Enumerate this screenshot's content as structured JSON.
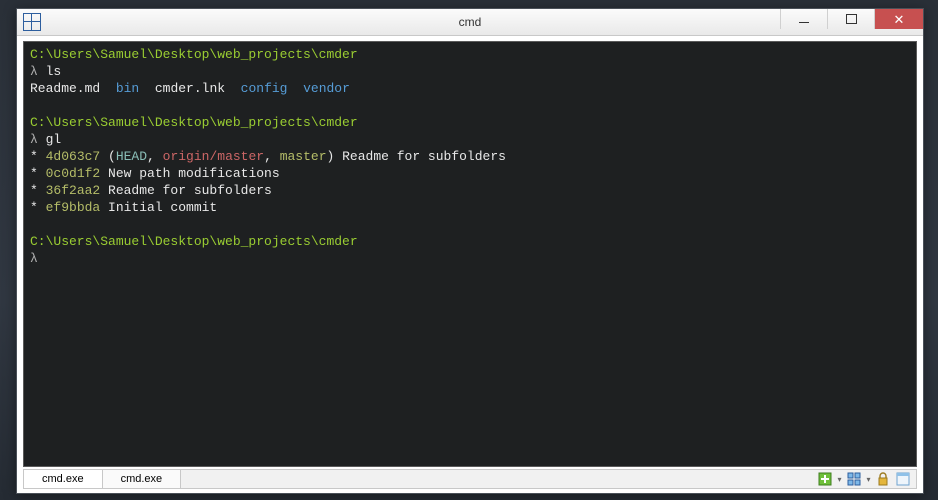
{
  "window": {
    "title": "cmd"
  },
  "tabs": [
    {
      "label": "cmd.exe",
      "active": true
    },
    {
      "label": "cmd.exe",
      "active": false
    }
  ],
  "terminal": {
    "path": "C:\\Users\\Samuel\\Desktop\\web_projects\\cmder",
    "prompt_symbol": "λ",
    "cmd_ls": "ls",
    "cmd_gl": "gl",
    "ls_plain1": "Readme.md",
    "ls_dir1": "bin",
    "ls_plain2": "cmder.lnk",
    "ls_dir2": "config",
    "ls_dir3": "vendor",
    "git": [
      {
        "star": "* ",
        "hash": "4d063c7",
        "open": " (",
        "head": "HEAD",
        "sep1": ", ",
        "remote": "origin/master",
        "sep2": ", ",
        "local": "master",
        "close": ") ",
        "msg": "Readme for subfolders"
      },
      {
        "star": "* ",
        "hash": "0c0d1f2",
        "msg": " New path modifications"
      },
      {
        "star": "* ",
        "hash": "36f2aa2",
        "msg": " Readme for subfolders"
      },
      {
        "star": "* ",
        "hash": "ef9bbda",
        "msg": " Initial commit"
      }
    ]
  }
}
